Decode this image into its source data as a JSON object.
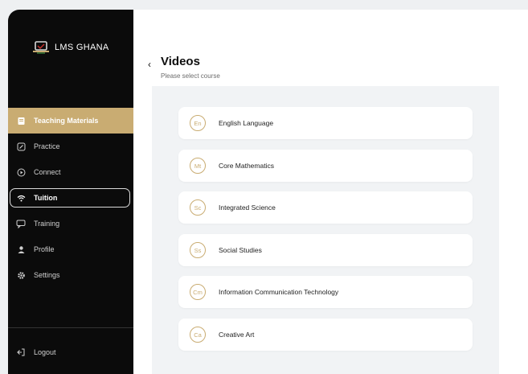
{
  "brand": {
    "name": "LMS GHANA"
  },
  "sidebar": {
    "items": [
      {
        "label": "Teaching Materials",
        "icon": "book-icon",
        "state": "active"
      },
      {
        "label": "Practice",
        "icon": "pencil-icon",
        "state": ""
      },
      {
        "label": "Connect",
        "icon": "play-circle-icon",
        "state": ""
      },
      {
        "label": "Tuition",
        "icon": "wifi-icon",
        "state": "outlined"
      },
      {
        "label": "Training",
        "icon": "chat-icon",
        "state": ""
      },
      {
        "label": "Profile",
        "icon": "user-icon",
        "state": ""
      },
      {
        "label": "Settings",
        "icon": "gear-icon",
        "state": ""
      }
    ],
    "logout": "Logout"
  },
  "header": {
    "title": "Videos",
    "subtitle": "Please select course"
  },
  "courses": [
    {
      "badge": "En",
      "name": "English Language"
    },
    {
      "badge": "Mt",
      "name": "Core Mathematics"
    },
    {
      "badge": "Sc",
      "name": "Integrated Science"
    },
    {
      "badge": "Ss",
      "name": "Social Studies"
    },
    {
      "badge": "Cm",
      "name": "Information Communication Technology"
    },
    {
      "badge": "Ca",
      "name": "Creative Art"
    }
  ],
  "colors": {
    "accent": "#c9ac72",
    "sidebar_bg": "#0b0b0b",
    "panel_bg": "#f1f3f5"
  }
}
